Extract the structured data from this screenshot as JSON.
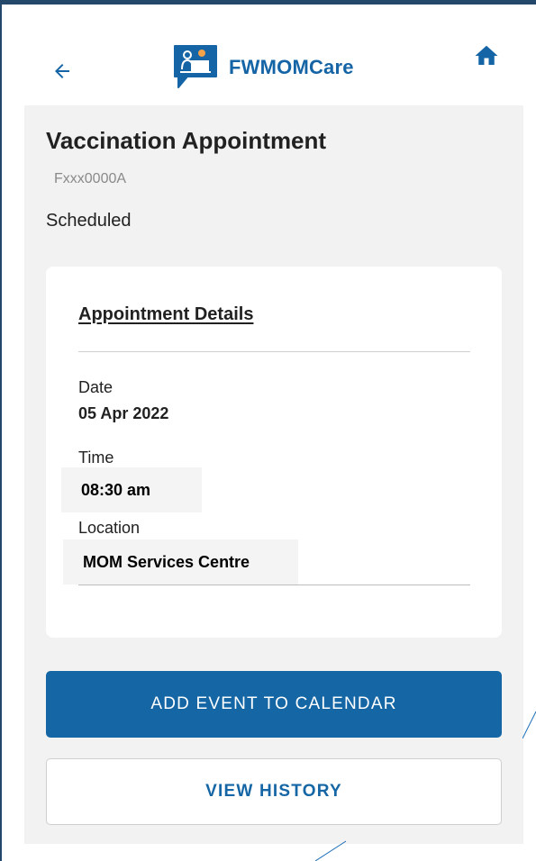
{
  "header": {
    "app_name": "FWMOMCare",
    "back_icon": "arrow-left-icon",
    "home_icon": "home-icon",
    "brand_color": "#1565a6"
  },
  "appointment": {
    "title": "Vaccination Appointment",
    "reference_id": "Fxxx0000A",
    "status": "Scheduled"
  },
  "details": {
    "heading": "Appointment Details",
    "date_label": "Date",
    "date_value": "05 Apr 2022",
    "time_label": "Time",
    "time_value": "08:30 am",
    "location_label": "Location",
    "location_value": "MOM Services Centre"
  },
  "actions": {
    "add_to_calendar": "ADD EVENT TO CALENDAR",
    "view_history": "VIEW HISTORY"
  },
  "colors": {
    "primary": "#1566a5",
    "panel_bg": "#f2f2f2",
    "frame": "#24486a"
  }
}
